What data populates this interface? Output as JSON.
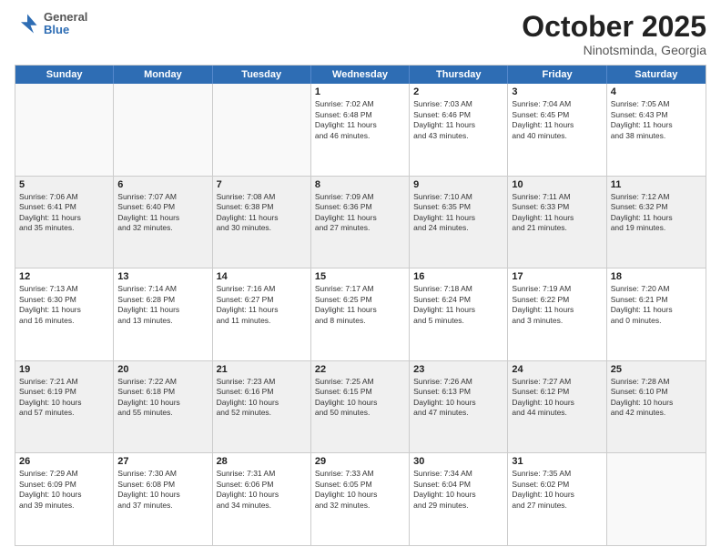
{
  "header": {
    "logo": {
      "general": "General",
      "blue": "Blue"
    },
    "title": "October 2025",
    "location": "Ninotsminda, Georgia"
  },
  "weekdays": [
    "Sunday",
    "Monday",
    "Tuesday",
    "Wednesday",
    "Thursday",
    "Friday",
    "Saturday"
  ],
  "rows": [
    [
      {
        "day": "",
        "info": ""
      },
      {
        "day": "",
        "info": ""
      },
      {
        "day": "",
        "info": ""
      },
      {
        "day": "1",
        "info": "Sunrise: 7:02 AM\nSunset: 6:48 PM\nDaylight: 11 hours\nand 46 minutes."
      },
      {
        "day": "2",
        "info": "Sunrise: 7:03 AM\nSunset: 6:46 PM\nDaylight: 11 hours\nand 43 minutes."
      },
      {
        "day": "3",
        "info": "Sunrise: 7:04 AM\nSunset: 6:45 PM\nDaylight: 11 hours\nand 40 minutes."
      },
      {
        "day": "4",
        "info": "Sunrise: 7:05 AM\nSunset: 6:43 PM\nDaylight: 11 hours\nand 38 minutes."
      }
    ],
    [
      {
        "day": "5",
        "info": "Sunrise: 7:06 AM\nSunset: 6:41 PM\nDaylight: 11 hours\nand 35 minutes."
      },
      {
        "day": "6",
        "info": "Sunrise: 7:07 AM\nSunset: 6:40 PM\nDaylight: 11 hours\nand 32 minutes."
      },
      {
        "day": "7",
        "info": "Sunrise: 7:08 AM\nSunset: 6:38 PM\nDaylight: 11 hours\nand 30 minutes."
      },
      {
        "day": "8",
        "info": "Sunrise: 7:09 AM\nSunset: 6:36 PM\nDaylight: 11 hours\nand 27 minutes."
      },
      {
        "day": "9",
        "info": "Sunrise: 7:10 AM\nSunset: 6:35 PM\nDaylight: 11 hours\nand 24 minutes."
      },
      {
        "day": "10",
        "info": "Sunrise: 7:11 AM\nSunset: 6:33 PM\nDaylight: 11 hours\nand 21 minutes."
      },
      {
        "day": "11",
        "info": "Sunrise: 7:12 AM\nSunset: 6:32 PM\nDaylight: 11 hours\nand 19 minutes."
      }
    ],
    [
      {
        "day": "12",
        "info": "Sunrise: 7:13 AM\nSunset: 6:30 PM\nDaylight: 11 hours\nand 16 minutes."
      },
      {
        "day": "13",
        "info": "Sunrise: 7:14 AM\nSunset: 6:28 PM\nDaylight: 11 hours\nand 13 minutes."
      },
      {
        "day": "14",
        "info": "Sunrise: 7:16 AM\nSunset: 6:27 PM\nDaylight: 11 hours\nand 11 minutes."
      },
      {
        "day": "15",
        "info": "Sunrise: 7:17 AM\nSunset: 6:25 PM\nDaylight: 11 hours\nand 8 minutes."
      },
      {
        "day": "16",
        "info": "Sunrise: 7:18 AM\nSunset: 6:24 PM\nDaylight: 11 hours\nand 5 minutes."
      },
      {
        "day": "17",
        "info": "Sunrise: 7:19 AM\nSunset: 6:22 PM\nDaylight: 11 hours\nand 3 minutes."
      },
      {
        "day": "18",
        "info": "Sunrise: 7:20 AM\nSunset: 6:21 PM\nDaylight: 11 hours\nand 0 minutes."
      }
    ],
    [
      {
        "day": "19",
        "info": "Sunrise: 7:21 AM\nSunset: 6:19 PM\nDaylight: 10 hours\nand 57 minutes."
      },
      {
        "day": "20",
        "info": "Sunrise: 7:22 AM\nSunset: 6:18 PM\nDaylight: 10 hours\nand 55 minutes."
      },
      {
        "day": "21",
        "info": "Sunrise: 7:23 AM\nSunset: 6:16 PM\nDaylight: 10 hours\nand 52 minutes."
      },
      {
        "day": "22",
        "info": "Sunrise: 7:25 AM\nSunset: 6:15 PM\nDaylight: 10 hours\nand 50 minutes."
      },
      {
        "day": "23",
        "info": "Sunrise: 7:26 AM\nSunset: 6:13 PM\nDaylight: 10 hours\nand 47 minutes."
      },
      {
        "day": "24",
        "info": "Sunrise: 7:27 AM\nSunset: 6:12 PM\nDaylight: 10 hours\nand 44 minutes."
      },
      {
        "day": "25",
        "info": "Sunrise: 7:28 AM\nSunset: 6:10 PM\nDaylight: 10 hours\nand 42 minutes."
      }
    ],
    [
      {
        "day": "26",
        "info": "Sunrise: 7:29 AM\nSunset: 6:09 PM\nDaylight: 10 hours\nand 39 minutes."
      },
      {
        "day": "27",
        "info": "Sunrise: 7:30 AM\nSunset: 6:08 PM\nDaylight: 10 hours\nand 37 minutes."
      },
      {
        "day": "28",
        "info": "Sunrise: 7:31 AM\nSunset: 6:06 PM\nDaylight: 10 hours\nand 34 minutes."
      },
      {
        "day": "29",
        "info": "Sunrise: 7:33 AM\nSunset: 6:05 PM\nDaylight: 10 hours\nand 32 minutes."
      },
      {
        "day": "30",
        "info": "Sunrise: 7:34 AM\nSunset: 6:04 PM\nDaylight: 10 hours\nand 29 minutes."
      },
      {
        "day": "31",
        "info": "Sunrise: 7:35 AM\nSunset: 6:02 PM\nDaylight: 10 hours\nand 27 minutes."
      },
      {
        "day": "",
        "info": ""
      }
    ]
  ]
}
